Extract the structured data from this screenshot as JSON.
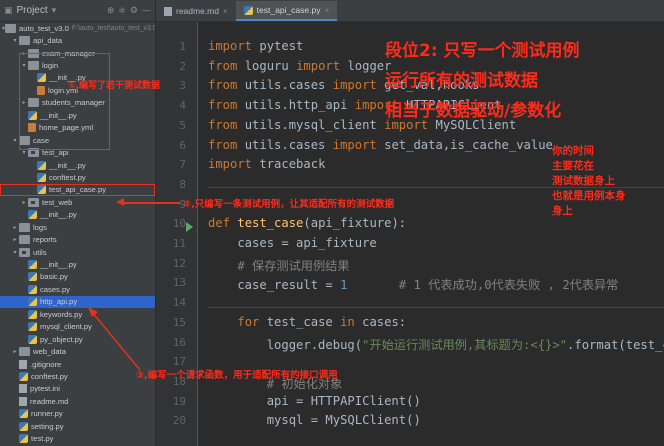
{
  "project_panel": {
    "title": "Project",
    "tree": [
      {
        "label": "auto_test_v3.0",
        "sub": "F:\\auto_test\\auto_test_v3.0",
        "indent": 0,
        "icon": "folder",
        "arrow": "open"
      },
      {
        "label": "api_data",
        "indent": 1,
        "icon": "folder",
        "arrow": "open"
      },
      {
        "label": "exam_manager",
        "indent": 2,
        "icon": "folder",
        "arrow": "closed"
      },
      {
        "label": "login",
        "indent": 2,
        "icon": "folder",
        "arrow": "open"
      },
      {
        "label": "__init__.py",
        "indent": 3,
        "icon": "py"
      },
      {
        "label": "login.yml",
        "indent": 3,
        "icon": "yml"
      },
      {
        "label": "students_manager",
        "indent": 2,
        "icon": "folder",
        "arrow": "closed"
      },
      {
        "label": "__init__.py",
        "indent": 2,
        "icon": "py"
      },
      {
        "label": "home_page.yml",
        "indent": 2,
        "icon": "yml"
      },
      {
        "label": "case",
        "indent": 1,
        "icon": "folder",
        "arrow": "open"
      },
      {
        "label": "test_api",
        "indent": 2,
        "icon": "pkg",
        "arrow": "open"
      },
      {
        "label": "__init__.py",
        "indent": 3,
        "icon": "py"
      },
      {
        "label": "conftest.py",
        "indent": 3,
        "icon": "py"
      },
      {
        "label": "test_api_case.py",
        "indent": 3,
        "icon": "py",
        "boxed": true
      },
      {
        "label": "test_web",
        "indent": 2,
        "icon": "pkg",
        "arrow": "closed"
      },
      {
        "label": "__init__.py",
        "indent": 2,
        "icon": "py"
      },
      {
        "label": "logs",
        "indent": 1,
        "icon": "folder",
        "arrow": "closed"
      },
      {
        "label": "reports",
        "indent": 1,
        "icon": "folder",
        "arrow": "closed"
      },
      {
        "label": "utils",
        "indent": 1,
        "icon": "pkg",
        "arrow": "open"
      },
      {
        "label": "__init__.py",
        "indent": 2,
        "icon": "py"
      },
      {
        "label": "basic.py",
        "indent": 2,
        "icon": "py"
      },
      {
        "label": "cases.py",
        "indent": 2,
        "icon": "py"
      },
      {
        "label": "http_api.py",
        "indent": 2,
        "icon": "py",
        "selected": true
      },
      {
        "label": "keywords.py",
        "indent": 2,
        "icon": "py"
      },
      {
        "label": "mysql_client.py",
        "indent": 2,
        "icon": "py"
      },
      {
        "label": "py_object.py",
        "indent": 2,
        "icon": "py"
      },
      {
        "label": "web_data",
        "indent": 1,
        "icon": "folder",
        "arrow": "closed"
      },
      {
        "label": ".gitignore",
        "indent": 1,
        "icon": "file"
      },
      {
        "label": "conftest.py",
        "indent": 1,
        "icon": "py"
      },
      {
        "label": "pytest.ini",
        "indent": 1,
        "icon": "file"
      },
      {
        "label": "readme.md",
        "indent": 1,
        "icon": "file"
      },
      {
        "label": "runner.py",
        "indent": 1,
        "icon": "py"
      },
      {
        "label": "setting.py",
        "indent": 1,
        "icon": "py"
      },
      {
        "label": "test.py",
        "indent": 1,
        "icon": "py"
      }
    ]
  },
  "tabs": [
    {
      "label": "readme.md",
      "active": false
    },
    {
      "label": "test_api_case.py",
      "active": true
    }
  ],
  "line_numbers": [
    "1",
    "2",
    "3",
    "4",
    "5",
    "6",
    "7",
    "8",
    "9",
    "10",
    "11",
    "12",
    "13",
    "14",
    "15",
    "16",
    "17",
    "18",
    "19",
    "20"
  ],
  "code_lines": [
    [
      {
        "t": "import ",
        "c": "kw"
      },
      {
        "t": "pytest",
        "c": ""
      }
    ],
    [
      {
        "t": "from ",
        "c": "kw"
      },
      {
        "t": "loguru ",
        "c": ""
      },
      {
        "t": "import ",
        "c": "kw"
      },
      {
        "t": "logger",
        "c": ""
      }
    ],
    [
      {
        "t": "from ",
        "c": "kw"
      },
      {
        "t": "utils.cases ",
        "c": ""
      },
      {
        "t": "import ",
        "c": "kw"
      },
      {
        "t": "get_val,hooks",
        "c": ""
      }
    ],
    [
      {
        "t": "from ",
        "c": "kw"
      },
      {
        "t": "utils.http_api ",
        "c": ""
      },
      {
        "t": "import ",
        "c": "kw"
      },
      {
        "t": "HTTPAPIClient",
        "c": ""
      }
    ],
    [
      {
        "t": "from ",
        "c": "kw"
      },
      {
        "t": "utils.mysql_client ",
        "c": ""
      },
      {
        "t": "import ",
        "c": "kw"
      },
      {
        "t": "MySQLClient",
        "c": ""
      }
    ],
    [
      {
        "t": "from ",
        "c": "kw"
      },
      {
        "t": "utils.cases ",
        "c": ""
      },
      {
        "t": "import ",
        "c": "kw"
      },
      {
        "t": "set_data,is_cache_value",
        "c": ""
      }
    ],
    [
      {
        "t": "import ",
        "c": "kw"
      },
      {
        "t": "traceback",
        "c": ""
      }
    ],
    [],
    [],
    [
      {
        "t": "def ",
        "c": "kw"
      },
      {
        "t": "test_case",
        "c": "fn"
      },
      {
        "t": "(api_fixture):",
        "c": ""
      }
    ],
    [
      {
        "t": "    cases = api_fixture",
        "c": ""
      }
    ],
    [
      {
        "t": "    # 保存测试用例结果",
        "c": "cmt"
      }
    ],
    [
      {
        "t": "    case_result = ",
        "c": ""
      },
      {
        "t": "1",
        "c": "num"
      },
      {
        "t": "       # 1 代表成功,0代表失败 , 2代表异常",
        "c": "cmt"
      }
    ],
    [],
    [
      {
        "t": "    ",
        "c": ""
      },
      {
        "t": "for ",
        "c": "kw"
      },
      {
        "t": "test_case ",
        "c": ""
      },
      {
        "t": "in ",
        "c": "kw"
      },
      {
        "t": "cases:",
        "c": ""
      }
    ],
    [
      {
        "t": "        logger.debug(",
        "c": ""
      },
      {
        "t": "\"开始运行测试用例,其标题为:<{}>\"",
        "c": "str"
      },
      {
        "t": ".format(test_ca",
        "c": ""
      }
    ],
    [],
    [
      {
        "t": "        # 初始化对象",
        "c": "cmt"
      }
    ],
    [
      {
        "t": "        api = HTTPAPIClient()",
        "c": ""
      }
    ],
    [
      {
        "t": "        mysql = MySQLClient()",
        "c": ""
      }
    ]
  ],
  "annotations": {
    "heading_1": "段位2: 只写一个测试用例",
    "heading_2": "运行所有的测试数据",
    "heading_3": "相当于数据驱动/参数化",
    "note_lines": [
      "你的时间",
      "主要花在",
      "测试数据身上",
      "也就是用例本身",
      "身上"
    ],
    "label_1": "①,编写了若干测试数据",
    "label_2": "②,只编写一条测试用例，让其适配所有的测试数据",
    "label_3": "③,编写一个请求函数，用于适配所有的接口调用"
  },
  "colors": {
    "annotation_red": "#ff2a1a",
    "selection_blue": "#2f65ca",
    "editor_bg": "#2b2b2b",
    "panel_bg": "#3c3f41"
  }
}
